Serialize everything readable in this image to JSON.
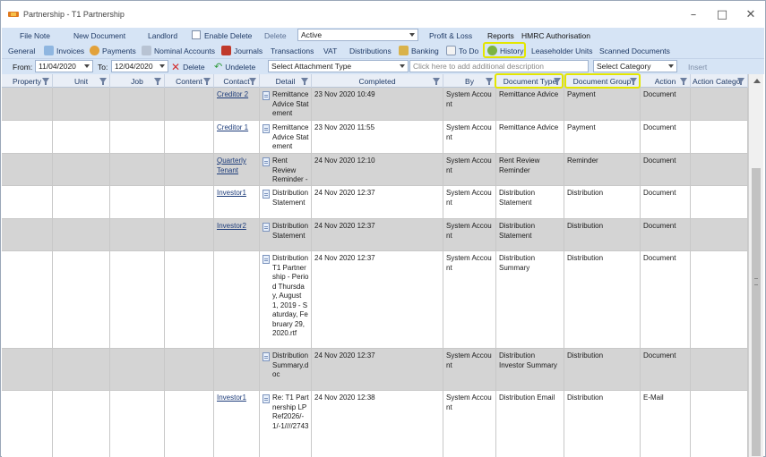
{
  "window": {
    "title": "Partnership - T1 Partnership"
  },
  "toolbar1": {
    "file_note": "File Note",
    "new_document": "New Document",
    "landlord": "Landlord",
    "enable_delete": "Enable Delete",
    "delete": "Delete",
    "status_select": "Active",
    "profit_loss": "Profit & Loss",
    "reports": "Reports",
    "hmrc": "HMRC Authorisation"
  },
  "toolbar2": {
    "general": "General",
    "invoices": "Invoices",
    "payments": "Payments",
    "nominal_accounts": "Nominal Accounts",
    "journals": "Journals",
    "transactions": "Transactions",
    "vat": "VAT",
    "distributions": "Distributions",
    "banking": "Banking",
    "todo": "To Do",
    "history": "History",
    "leaseholder_units": "Leaseholder Units",
    "scanned_documents": "Scanned Documents"
  },
  "toolbar3": {
    "from_label": "From:",
    "from_value": "11/04/2020",
    "to_label": "To:",
    "to_value": "12/04/2020",
    "delete": "Delete",
    "undelete": "Undelete",
    "attachment_type": "Select Attachment Type",
    "description_placeholder": "Click here to add additional description",
    "category": "Select Category",
    "insert": "Insert"
  },
  "columns": {
    "property": "Property",
    "unit": "Unit",
    "job": "Job",
    "content": "Content",
    "contact": "Contact",
    "detail": "Detail",
    "completed": "Completed",
    "by": "By",
    "document_type": "Document Type",
    "document_group": "Document Group",
    "action": "Action",
    "action_category": "Action Catego"
  },
  "rows": [
    {
      "contact": "Creditor 2",
      "detail": "Remittance Advice Statement",
      "completed": "23 Nov 2020 10:49",
      "by": "System Account",
      "doc_type": "Remittance Advice",
      "doc_group": "Payment",
      "action": "Document"
    },
    {
      "contact": "Creditor 1",
      "detail": "Remittance Advice Statement",
      "completed": "23 Nov 2020 11:55",
      "by": "System Account",
      "doc_type": "Remittance Advice",
      "doc_group": "Payment",
      "action": "Document"
    },
    {
      "contact": "Quarterly Tenant",
      "detail": "Rent Review Reminder -",
      "completed": "24 Nov 2020 12:10",
      "by": "System Account",
      "doc_type": "Rent Review Reminder",
      "doc_group": "Reminder",
      "action": "Document"
    },
    {
      "contact": "Investor1",
      "detail": "Distribution Statement",
      "completed": "24 Nov 2020 12:37",
      "by": "System Account",
      "doc_type": "Distribution Statement",
      "doc_group": "Distribution",
      "action": "Document"
    },
    {
      "contact": "Investor2",
      "detail": "Distribution Statement",
      "completed": "24 Nov 2020 12:37",
      "by": "System Account",
      "doc_type": "Distribution Statement",
      "doc_group": "Distribution",
      "action": "Document"
    },
    {
      "contact": "",
      "detail": "Distribution T1 Partnership - Period Thursday, August 1, 2019 - Saturday, February 29, 2020.rtf",
      "completed": "24 Nov 2020 12:37",
      "by": "System Account",
      "doc_type": "Distribution Summary",
      "doc_group": "Distribution",
      "action": "Document"
    },
    {
      "contact": "",
      "detail": "Distribution Summary.doc",
      "completed": "24 Nov 2020 12:37",
      "by": "System Account",
      "doc_type": "Distribution Investor Summary",
      "doc_group": "Distribution",
      "action": "Document"
    },
    {
      "contact": "Investor1",
      "detail": "Re: T1 Partnership LP Ref2026/-1/-1////2743",
      "completed": "24 Nov 2020 12:38",
      "by": "System Account",
      "doc_type": "Distribution Email",
      "doc_group": "Distribution",
      "action": "E-Mail"
    }
  ]
}
